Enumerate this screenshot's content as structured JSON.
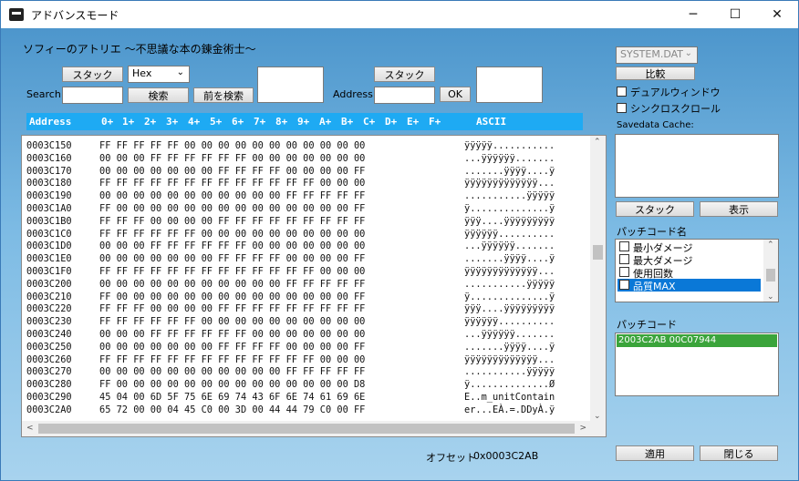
{
  "window": {
    "title": "アドバンスモード",
    "minimize": "─",
    "maximize": "☐",
    "close": "✕"
  },
  "header": {
    "game_title": "ソフィーのアトリエ 〜不思議な本の錬金術士〜"
  },
  "search": {
    "stack_button": "スタック",
    "mode_select": "Hex",
    "label": "Search",
    "value": "",
    "search_button": "検索",
    "prev_button": "前を検索"
  },
  "address": {
    "stack_button": "スタック",
    "label": "Address",
    "value": "",
    "ok_button": "OK"
  },
  "hex_header": {
    "address": "Address",
    "columns": [
      "0+",
      "1+",
      "2+",
      "3+",
      "4+",
      "5+",
      "6+",
      "7+",
      "8+",
      "9+",
      "A+",
      "B+",
      "C+",
      "D+",
      "E+",
      "F+"
    ],
    "ascii": "ASCII"
  },
  "hex_rows": [
    {
      "addr": "0003C150",
      "bytes": "FF FF FF FF FF 00 00 00 00 00 00 00 00 00 00 00",
      "ascii": "ÿÿÿÿÿ..........."
    },
    {
      "addr": "0003C160",
      "bytes": "00 00 00 FF FF FF FF FF FF 00 00 00 00 00 00 00",
      "ascii": "...ÿÿÿÿÿÿ......."
    },
    {
      "addr": "0003C170",
      "bytes": "00 00 00 00 00 00 00 FF FF FF FF 00 00 00 00 FF",
      "ascii": ".......ÿÿÿÿ....ÿ"
    },
    {
      "addr": "0003C180",
      "bytes": "FF FF FF FF FF FF FF FF FF FF FF FF FF 00 00 00",
      "ascii": "ÿÿÿÿÿÿÿÿÿÿÿÿÿ..."
    },
    {
      "addr": "0003C190",
      "bytes": "00 00 00 00 00 00 00 00 00 00 00 FF FF FF FF FF",
      "ascii": "...........ÿÿÿÿÿ"
    },
    {
      "addr": "0003C1A0",
      "bytes": "FF 00 00 00 00 00 00 00 00 00 00 00 00 00 00 FF",
      "ascii": "ÿ..............ÿ"
    },
    {
      "addr": "0003C1B0",
      "bytes": "FF FF FF 00 00 00 00 FF FF FF FF FF FF FF FF FF",
      "ascii": "ÿÿÿ....ÿÿÿÿÿÿÿÿÿ"
    },
    {
      "addr": "0003C1C0",
      "bytes": "FF FF FF FF FF FF 00 00 00 00 00 00 00 00 00 00",
      "ascii": "ÿÿÿÿÿÿ.........."
    },
    {
      "addr": "0003C1D0",
      "bytes": "00 00 00 FF FF FF FF FF FF 00 00 00 00 00 00 00",
      "ascii": "...ÿÿÿÿÿÿ......."
    },
    {
      "addr": "0003C1E0",
      "bytes": "00 00 00 00 00 00 00 FF FF FF FF 00 00 00 00 FF",
      "ascii": ".......ÿÿÿÿ....ÿ"
    },
    {
      "addr": "0003C1F0",
      "bytes": "FF FF FF FF FF FF FF FF FF FF FF FF FF 00 00 00",
      "ascii": "ÿÿÿÿÿÿÿÿÿÿÿÿÿ..."
    },
    {
      "addr": "0003C200",
      "bytes": "00 00 00 00 00 00 00 00 00 00 00 FF FF FF FF FF",
      "ascii": "...........ÿÿÿÿÿ"
    },
    {
      "addr": "0003C210",
      "bytes": "FF 00 00 00 00 00 00 00 00 00 00 00 00 00 00 FF",
      "ascii": "ÿ..............ÿ"
    },
    {
      "addr": "0003C220",
      "bytes": "FF FF FF 00 00 00 00 FF FF FF FF FF FF FF FF FF",
      "ascii": "ÿÿÿ....ÿÿÿÿÿÿÿÿÿ"
    },
    {
      "addr": "0003C230",
      "bytes": "FF FF FF FF FF FF 00 00 00 00 00 00 00 00 00 00",
      "ascii": "ÿÿÿÿÿÿ.........."
    },
    {
      "addr": "0003C240",
      "bytes": "00 00 00 FF FF FF FF FF FF 00 00 00 00 00 00 00",
      "ascii": "...ÿÿÿÿÿÿ......."
    },
    {
      "addr": "0003C250",
      "bytes": "00 00 00 00 00 00 00 FF FF FF FF 00 00 00 00 FF",
      "ascii": ".......ÿÿÿÿ....ÿ"
    },
    {
      "addr": "0003C260",
      "bytes": "FF FF FF FF FF FF FF FF FF FF FF FF FF 00 00 00",
      "ascii": "ÿÿÿÿÿÿÿÿÿÿÿÿÿ..."
    },
    {
      "addr": "0003C270",
      "bytes": "00 00 00 00 00 00 00 00 00 00 00 FF FF FF FF FF",
      "ascii": "...........ÿÿÿÿÿ"
    },
    {
      "addr": "0003C280",
      "bytes": "FF 00 00 00 00 00 00 00 00 00 00 00 00 00 00 D8",
      "ascii": "ÿ..............Ø"
    },
    {
      "addr": "0003C290",
      "bytes": "45 04 00 6D 5F 75 6E 69 74 43 6F 6E 74 61 69 6E",
      "ascii": "E..m_unitContain"
    },
    {
      "addr": "0003C2A0",
      "bytes": "65 72 00 00 04 45 C0 00 3D 00 44 44 79 C0 00 FF",
      "ascii": "er...EÀ.=.DDyÀ.ÿ"
    }
  ],
  "right_panel": {
    "file_select": "SYSTEM.DAT",
    "compare_button": "比較",
    "dual_window": "デュアルウィンドウ",
    "sync_scroll": "シンクロスクロール",
    "savedata_cache_label": "Savedata Cache:",
    "stack_button": "スタック",
    "show_button": "表示",
    "patch_name_label": "パッチコード名",
    "patch_names": [
      "最小ダメージ",
      "最大ダメージ",
      "使用回数",
      "品質MAX"
    ],
    "patch_code_label": "パッチコード",
    "patch_codes": [
      "2003C2AB 00C07944"
    ]
  },
  "footer": {
    "offset_label": "オフセット",
    "offset_value": "0x0003C2AB",
    "apply_button": "適用",
    "close_button": "閉じる"
  },
  "colors": {
    "header_bar": "#1eaaf3",
    "selection": "#0a78d7",
    "patch_code_bg": "#3ba43b"
  }
}
